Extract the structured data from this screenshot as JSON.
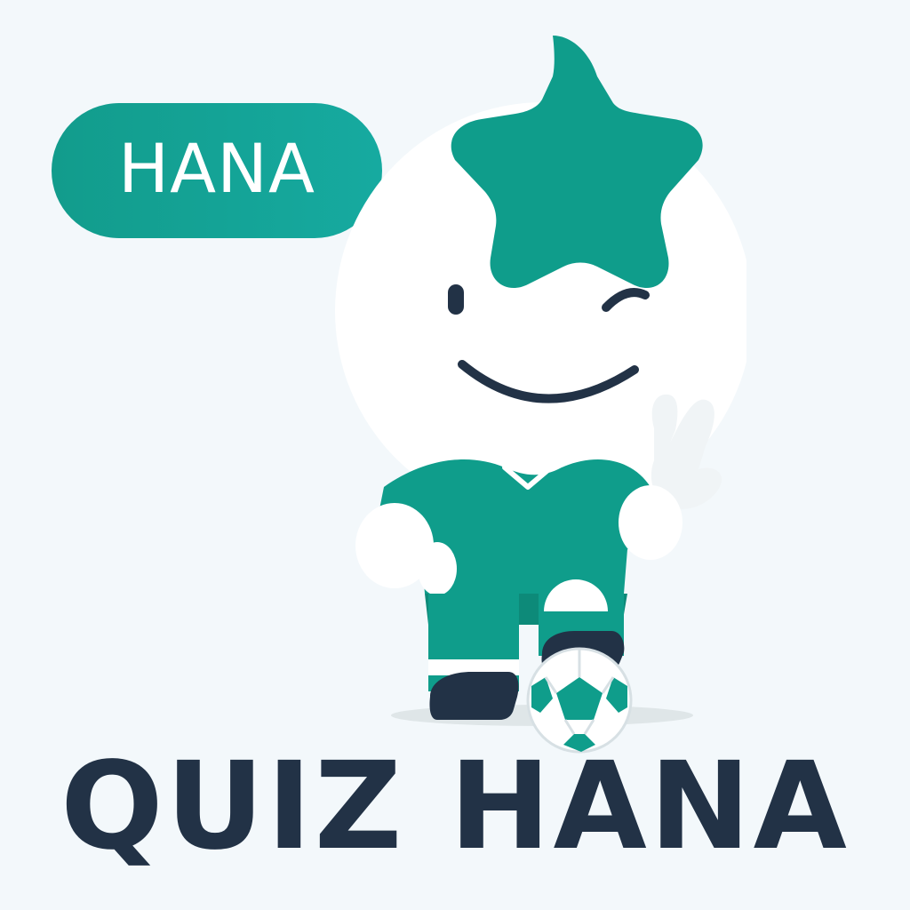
{
  "badge": {
    "label": "HANA"
  },
  "footer": {
    "title": "QUIZ HANA"
  },
  "mascot": {
    "icon": "mascot-icon",
    "star_icon": "star-icon",
    "ball_icon": "soccer-ball-icon",
    "colors": {
      "teal": "#0f9d8b",
      "navy": "#223246",
      "white": "#ffffff",
      "background": "#f3f8fb"
    }
  }
}
